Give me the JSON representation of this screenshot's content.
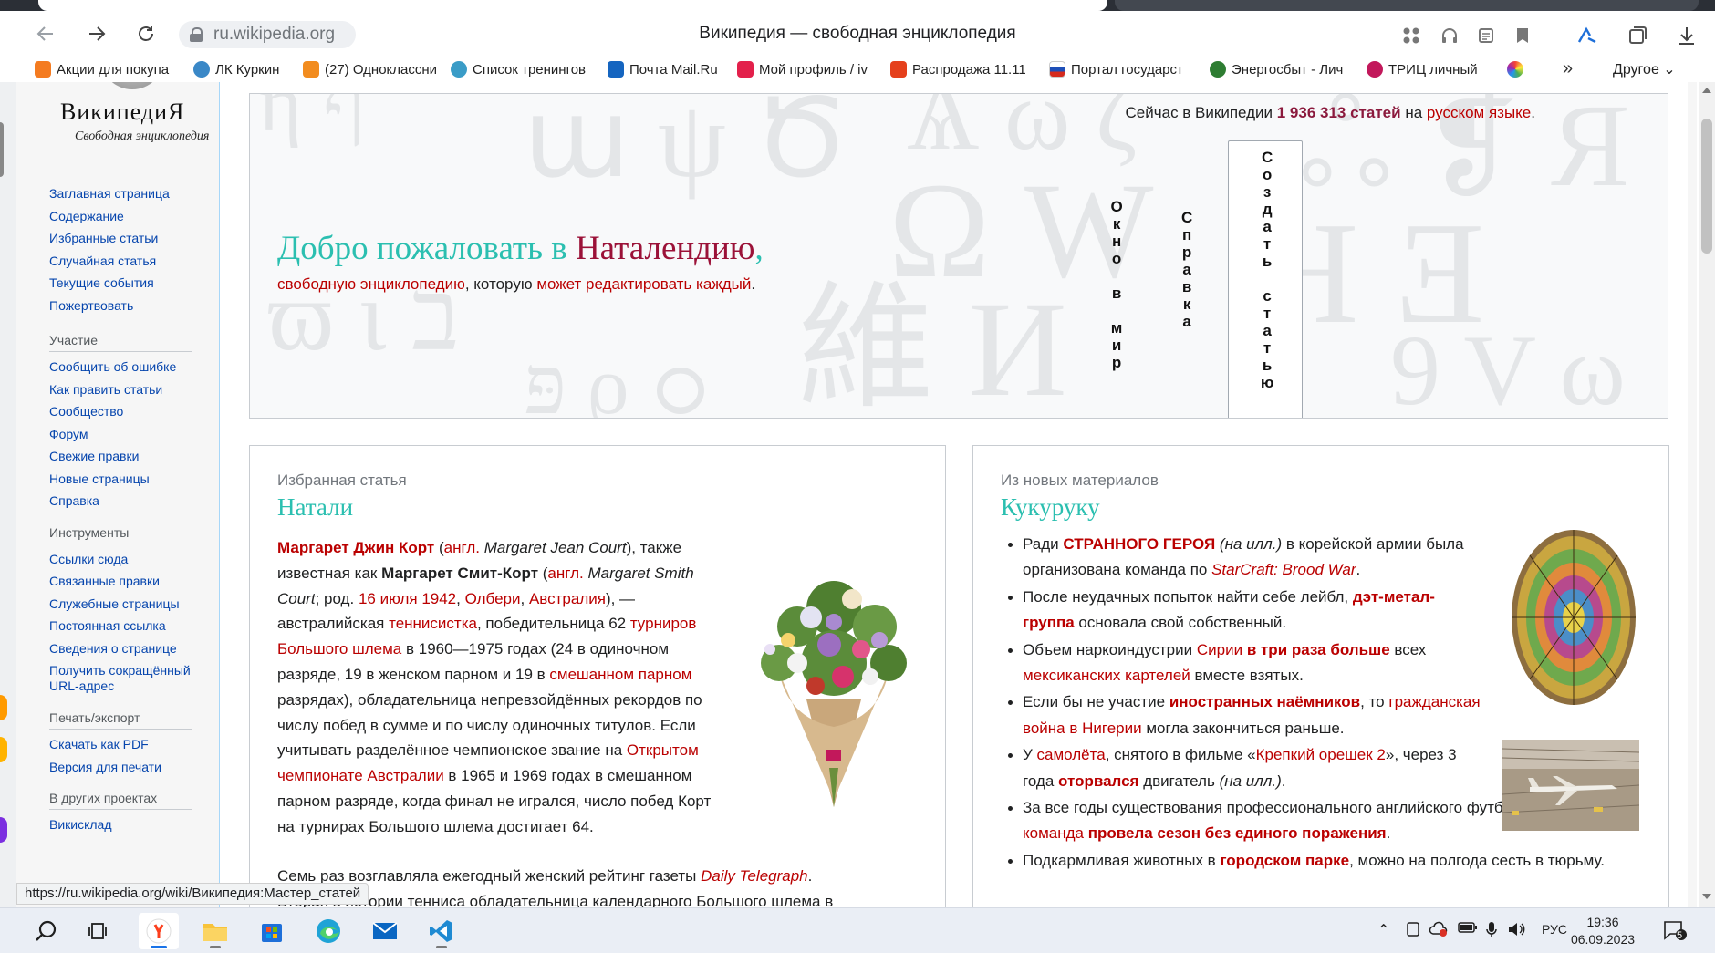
{
  "browser": {
    "url": "ru.wikipedia.org",
    "title": "Википедия — свободная энциклопедия",
    "bookmarks": [
      {
        "label": "Акции для покупа",
        "color": "#f47b20"
      },
      {
        "label": "ЛК Куркин",
        "color": "#3a88c7"
      },
      {
        "label": "(27) Одноклассни",
        "color": "#f28c1f"
      },
      {
        "label": "Список тренингов",
        "color": "#3a9cc7"
      },
      {
        "label": "Почта Mail.Ru",
        "color": "#1565c0"
      },
      {
        "label": "Мой профиль / iv",
        "color": "#e3204b"
      },
      {
        "label": "Распродажа 11.11",
        "color": "#e5401c"
      },
      {
        "label": "Портал государст",
        "color": "#d52b1e"
      },
      {
        "label": "Энергосбыт - Лич",
        "color": "#2e7d32"
      },
      {
        "label": "ТРИЦ личный",
        "color": "#c2185b"
      }
    ],
    "bookmarks_more": "»",
    "bookmarks_other": "Другое",
    "status_url": "https://ru.wikipedia.org/wiki/Википедия:Мастер_статей"
  },
  "wiki": {
    "logo_word": "ВикипедиЯ",
    "logo_tagline": "Свободная энциклопедия",
    "nav_main": [
      "Заглавная страница",
      "Содержание",
      "Избранные статьи",
      "Случайная статья",
      "Текущие события",
      "Пожертвовать"
    ],
    "nav_sections": [
      {
        "title": "Участие",
        "items": [
          "Сообщить об ошибке",
          "Как править статьи",
          "Сообщество",
          "Форум",
          "Свежие правки",
          "Новые страницы",
          "Справка"
        ]
      },
      {
        "title": "Инструменты",
        "items": [
          "Ссылки сюда",
          "Связанные правки",
          "Служебные страницы",
          "Постоянная ссылка",
          "Сведения о странице",
          "Получить сокращённый URL-адрес"
        ]
      },
      {
        "title": "Печать/экспорт",
        "items": [
          "Скачать как PDF",
          "Версия для печати"
        ]
      },
      {
        "title": "В других проектах",
        "items": [
          "Викисклад"
        ]
      }
    ],
    "banner": {
      "count_prefix": "Сейчас в Википедии",
      "count_number": "1 936 313 статей",
      "count_on": "на",
      "count_lang": "русском языке",
      "count_end": ".",
      "welcome_prefix": "Добро пожаловать в",
      "welcome_name": "Наталендию",
      "welcome_comma": ",",
      "sub_link1": "свободную энциклопедию",
      "sub_mid": ", которую",
      "sub_link2": "может редактировать каждый",
      "sub_end": ".",
      "vertical_links": [
        "Окно в мир",
        "Справка",
        "Создать статью"
      ]
    },
    "featured": {
      "label": "Избранная статья",
      "title": "Натали"
    },
    "dyk": {
      "label": "Из новых материалов",
      "title": "Кукуруку"
    }
  },
  "taskbar": {
    "lang": "РУС",
    "time": "19:36",
    "date": "06.09.2023",
    "notifications": "5"
  }
}
